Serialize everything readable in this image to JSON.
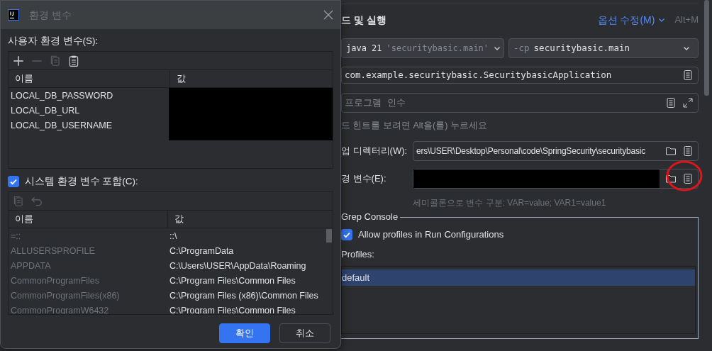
{
  "dialog": {
    "title": "환경 변수",
    "user_section": {
      "label": "사용자 환경 변수(S):",
      "toolbar": [
        {
          "kind": "add",
          "disabled": false
        },
        {
          "kind": "remove",
          "disabled": true
        },
        {
          "kind": "copy",
          "disabled": true
        },
        {
          "kind": "paste",
          "disabled": false
        }
      ],
      "columns": [
        "이름",
        "값"
      ],
      "rows": [
        {
          "name": "LOCAL_DB_PASSWORD"
        },
        {
          "name": "LOCAL_DB_URL"
        },
        {
          "name": "LOCAL_DB_USERNAME"
        }
      ]
    },
    "include_system": {
      "label": "시스템 환경 변수 포함(C):",
      "checked": true
    },
    "system_section": {
      "toolbar": [
        {
          "kind": "copy",
          "disabled": true
        },
        {
          "kind": "undo",
          "disabled": true
        }
      ],
      "columns": [
        "이름",
        "값"
      ],
      "rows": [
        {
          "name": "=::",
          "value": "::\\"
        },
        {
          "name": "ALLUSERSPROFILE",
          "value": "C:\\ProgramData"
        },
        {
          "name": "APPDATA",
          "value": "C:\\Users\\USER\\AppData\\Roaming"
        },
        {
          "name": "CommonProgramFiles",
          "value": "C:\\Program Files\\Common Files"
        },
        {
          "name": "CommonProgramFiles(x86)",
          "value": "C:\\Program Files (x86)\\Common Files"
        },
        {
          "name": "CommonProgramW6432",
          "value": "C:\\Program Files\\Common Files"
        }
      ]
    },
    "buttons": [
      {
        "label": "확인",
        "primary": true
      },
      {
        "label": "취소",
        "primary": false
      }
    ]
  },
  "run_config": {
    "heading": "드 및 실행",
    "modify_options": {
      "label": "옵션 수정(M)",
      "shortcut": "Alt+M"
    },
    "jre": {
      "value": "java 21",
      "hint": "'securitybasic.main'"
    },
    "module": {
      "prefix": "-cp",
      "value": "securitybasic.main"
    },
    "main_class": "com.example.securitybasic.SecuritybasicApplication",
    "program_args": {
      "placeholder": "프로그램 인수"
    },
    "hint": "드 힌트를 보려면 Alt을(를) 누르세요",
    "working_dir": {
      "label": "업 디렉터리(W):",
      "value": "ers\\USER\\Desktop\\Personal\\code\\SpringSecurity\\securitybasic"
    },
    "env_vars": {
      "label": "경 변수(E):",
      "hint": "세미콜론으로 변수 구분: VAR=value; VAR1=value1"
    },
    "grep_console": {
      "title": "Grep Console",
      "allow_profiles": {
        "label": "Allow profiles in Run Configurations",
        "checked": true
      },
      "profiles_label": "Profiles:",
      "profiles": [
        {
          "name": "default",
          "selected": true
        }
      ]
    }
  }
}
